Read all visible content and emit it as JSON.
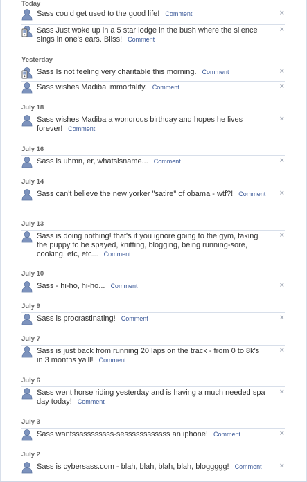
{
  "comment_label": "Comment",
  "remove_glyph": "×",
  "groups": [
    {
      "label": "Today",
      "items": [
        {
          "text": "Sass could get used to the good life!",
          "icon": "user-icon"
        },
        {
          "text": "Sass Just woke up in a 5 star lodge in the bush where the silence sings in one's ears. Bliss!",
          "icon": "mobile-user-icon"
        }
      ]
    },
    {
      "label": "Yesterday",
      "items": [
        {
          "text": "Sass Is not feeling very charitable this morning.",
          "icon": "mobile-user-icon"
        },
        {
          "text": "Sass wishes Madiba immortality.",
          "icon": "user-icon"
        }
      ]
    },
    {
      "label": "July 18",
      "items": [
        {
          "text": "Sass wishes Madiba a wondrous birthday and hopes he lives forever!",
          "icon": "user-icon"
        }
      ]
    },
    {
      "label": "July 16",
      "items": [
        {
          "text": "Sass is uhmn, er, whatsisname...",
          "icon": "user-icon"
        }
      ]
    },
    {
      "label": "July 14",
      "items": [
        {
          "text": "Sass can't believe the new yorker \"satire\" of obama - wtf?!",
          "icon": "user-icon"
        }
      ]
    },
    {
      "label": "July 13",
      "items": [
        {
          "text": "Sass is doing nothing! that's if you ignore going to the gym, taking the puppy to be spayed, knitting, blogging, being running-sore, cooking, etc, etc...",
          "icon": "user-icon"
        }
      ]
    },
    {
      "label": "July 10",
      "items": [
        {
          "text": "Sass - hi-ho, hi-ho...",
          "icon": "user-icon"
        }
      ]
    },
    {
      "label": "July 9",
      "items": [
        {
          "text": "Sass is procrastinating!",
          "icon": "user-icon"
        }
      ]
    },
    {
      "label": "July 7",
      "items": [
        {
          "text": "Sass is just back from running 20 laps on the track - from 0 to 8k's in 3 months ya'll!",
          "icon": "user-icon"
        }
      ]
    },
    {
      "label": "July 6",
      "items": [
        {
          "text": "Sass went horse riding yesterday and is having a much needed spa day today!",
          "icon": "user-icon"
        }
      ]
    },
    {
      "label": "July 3",
      "items": [
        {
          "text": "Sass wantsssssssssss-sessssssssssss an iphone!",
          "icon": "user-icon"
        }
      ]
    },
    {
      "label": "July 2",
      "items": [
        {
          "text": "Sass is cybersass.com - blah, blah, blah, blah, bloggggg!",
          "icon": "user-icon"
        }
      ]
    }
  ]
}
